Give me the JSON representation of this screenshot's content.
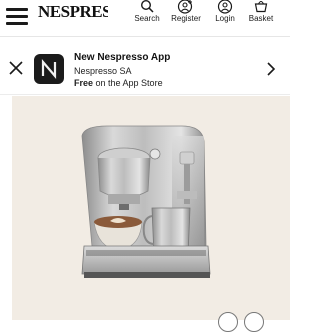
{
  "header": {
    "logo_text": "NESPRESSO",
    "nav": [
      {
        "label": "Search",
        "icon": "search-icon"
      },
      {
        "label": "Register",
        "icon": "register-icon"
      },
      {
        "label": "Login",
        "icon": "login-icon"
      },
      {
        "label": "Basket",
        "icon": "basket-icon"
      }
    ]
  },
  "banner": {
    "title": "New Nespresso App",
    "publisher": "Nespresso SA",
    "price_word": "Free",
    "price_rest": " on the App Store",
    "app_icon_letter": "N"
  },
  "product": {
    "image": "espresso-machine-image"
  },
  "colors": {
    "hero_background": "#f2ece4",
    "text": "#1a1a1a"
  }
}
